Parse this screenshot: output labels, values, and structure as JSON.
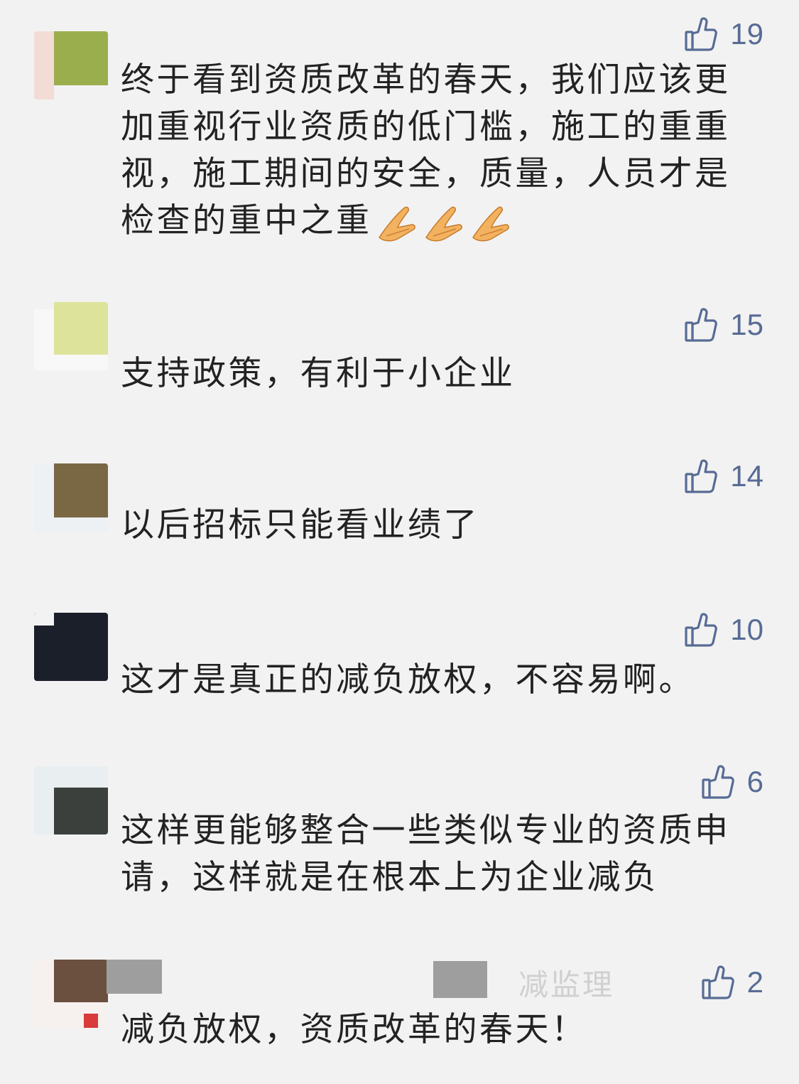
{
  "comments": [
    {
      "name": "",
      "likes": "19",
      "text": "终于看到资质改革的春天，我们应该更加重视行业资质的低门槛，施工的重重视，施工期间的安全，质量，人员才是检查的重中之重",
      "emoji": [
        "praying-hands-icon",
        "praying-hands-icon",
        "praying-hands-icon"
      ],
      "avatar_color": "#9bae4e"
    },
    {
      "name": "",
      "likes": "15",
      "text": "支持政策，有利于小企业",
      "avatar_color": "#dde39a"
    },
    {
      "name": "",
      "likes": "14",
      "text": "以后招标只能看业绩了",
      "avatar_color": "#7a6744"
    },
    {
      "name": "",
      "likes": "10",
      "text": "这才是真正的减负放权，不容易啊。",
      "avatar_color": "#1b1f2a"
    },
    {
      "name": "",
      "likes": "6",
      "text": "这样更能够整合一些类似专业的资质申请，这样就是在根本上为企业减负",
      "avatar_color": "#3b403c"
    },
    {
      "name": "减监理",
      "likes": "2",
      "text": "减负放权，资质改革的春天！",
      "avatar_color": "#6b4f3f"
    }
  ],
  "colors": {
    "background": "#f2f2f2",
    "like_blue": "#576b95",
    "text": "#222222"
  }
}
